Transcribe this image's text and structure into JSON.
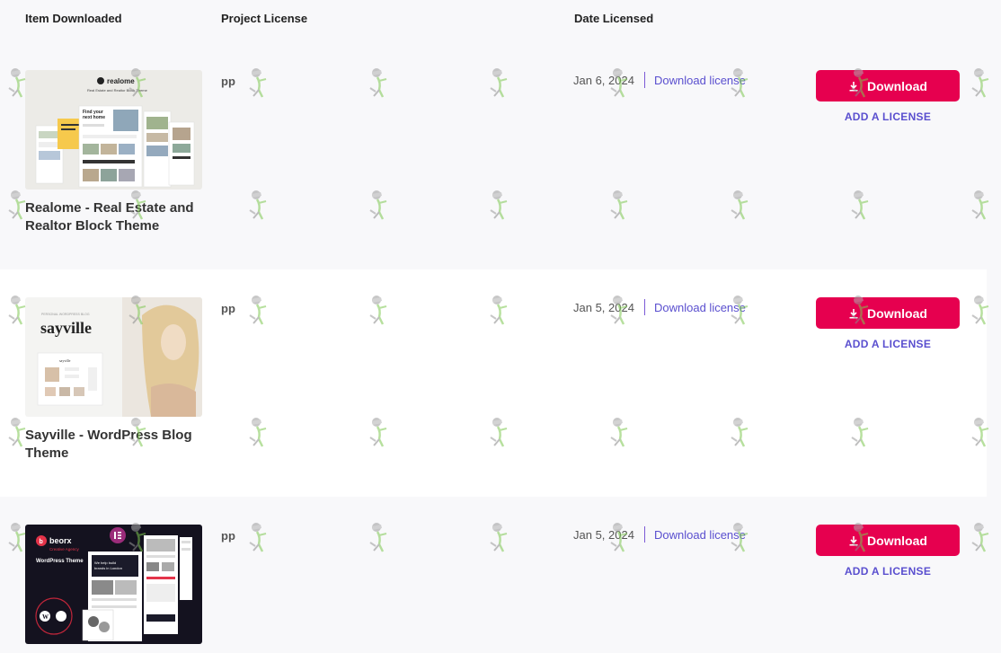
{
  "headers": {
    "item": "Item Downloaded",
    "project": "Project License",
    "date": "Date Licensed"
  },
  "rows": [
    {
      "title": "Realome - Real Estate and Realtor Block Theme",
      "thumb_logo": "realome",
      "thumb_sub": "Real Estate and Realtor Block Theme",
      "thumb_headline": "Find your next home",
      "project": "pp",
      "date": "Jan 6, 2024",
      "link": "Download license",
      "button": "Download",
      "add": "ADD A LICENSE"
    },
    {
      "title": "Sayville - WordPress Blog Theme",
      "thumb_logo": "sayville",
      "project": "pp",
      "date": "Jan 5, 2024",
      "link": "Download license",
      "button": "Download",
      "add": "ADD A LICENSE"
    },
    {
      "title": "",
      "thumb_logo": "beorx",
      "thumb_sub": "Creative Agency",
      "thumb_headline": "WordPress Theme",
      "project": "pp",
      "date": "Jan 5, 2024",
      "link": "Download license",
      "button": "Download",
      "add": "ADD A LICENSE"
    }
  ],
  "colors": {
    "button": "#e6004f",
    "link": "#5a4fcf"
  },
  "icons": {
    "download": "download-icon",
    "elementor": "elementor-icon",
    "wordpress": "wordpress-icon",
    "watermark": "watermark-figure-icon"
  }
}
